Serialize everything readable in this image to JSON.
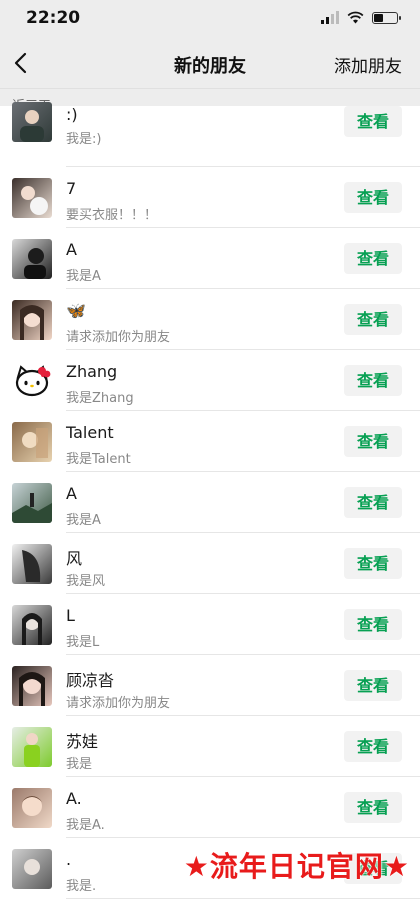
{
  "status": {
    "time": "22:20"
  },
  "nav": {
    "title": "新的朋友",
    "add_label": "添加朋友"
  },
  "section": {
    "label": "近三天"
  },
  "colors": {
    "accent": "#07a053",
    "header_bg": "#ededed",
    "button_bg": "#f2f2f2",
    "watermark": "#e81b1b"
  },
  "friends": [
    {
      "name": ":)",
      "message": "我是:)",
      "button": "查看",
      "avatar": "avatar-photo"
    },
    {
      "name": "7",
      "message": "要买衣服！！！",
      "button": "查看",
      "avatar": "avatar-photo"
    },
    {
      "name": "A",
      "message": "我是A",
      "button": "查看",
      "avatar": "avatar-photo"
    },
    {
      "name": "🦋",
      "message": "请求添加你为朋友",
      "button": "查看",
      "avatar": "avatar-photo"
    },
    {
      "name": "Zhang",
      "message": "我是Zhang",
      "button": "查看",
      "avatar": "hello-kitty-icon"
    },
    {
      "name": "Talent",
      "message": "我是Talent",
      "button": "查看",
      "avatar": "avatar-photo"
    },
    {
      "name": "A",
      "message": "我是A",
      "button": "查看",
      "avatar": "avatar-photo"
    },
    {
      "name": "风",
      "message": "我是风",
      "button": "查看",
      "avatar": "avatar-photo"
    },
    {
      "name": "L",
      "message": "我是L",
      "button": "查看",
      "avatar": "avatar-photo"
    },
    {
      "name": "顾凉沓",
      "message": "请求添加你为朋友",
      "button": "查看",
      "avatar": "avatar-photo"
    },
    {
      "name": "苏娃",
      "message": "我是",
      "button": "查看",
      "avatar": "avatar-photo"
    },
    {
      "name": "A.",
      "message": "我是A.",
      "button": "查看",
      "avatar": "avatar-photo"
    },
    {
      "name": ".",
      "message": "我是.",
      "button": "查看",
      "avatar": "avatar-photo"
    }
  ],
  "watermark": "★流年日记官网★"
}
